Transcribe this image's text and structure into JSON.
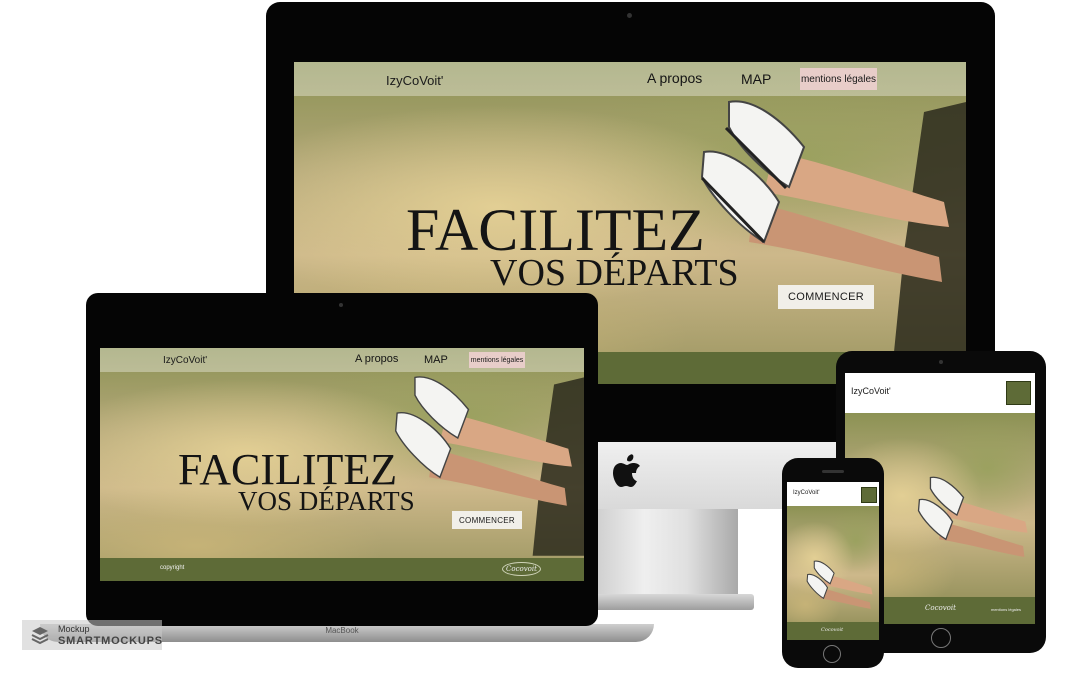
{
  "site": {
    "brand": "IzyCoVoit'",
    "nav": {
      "about": "A propos",
      "map": "MAP",
      "legal": "mentions légales"
    },
    "headline_line1": "FACILITEZ",
    "headline_line2": "VOS DÉPARTS",
    "cta": "COMMENCER",
    "footer_copyright": "copyright",
    "footer_legal_small": "mentions légales",
    "signature": "Cocovoit"
  },
  "devices": {
    "laptop_label": "MacBook"
  },
  "watermark": {
    "line1": "Mockup",
    "line2": "SMARTMOCKUPS"
  },
  "colors": {
    "footer_green": "#5e6b37",
    "legal_pink": "#e8cdc9",
    "cta_bg": "#f1efe9"
  }
}
